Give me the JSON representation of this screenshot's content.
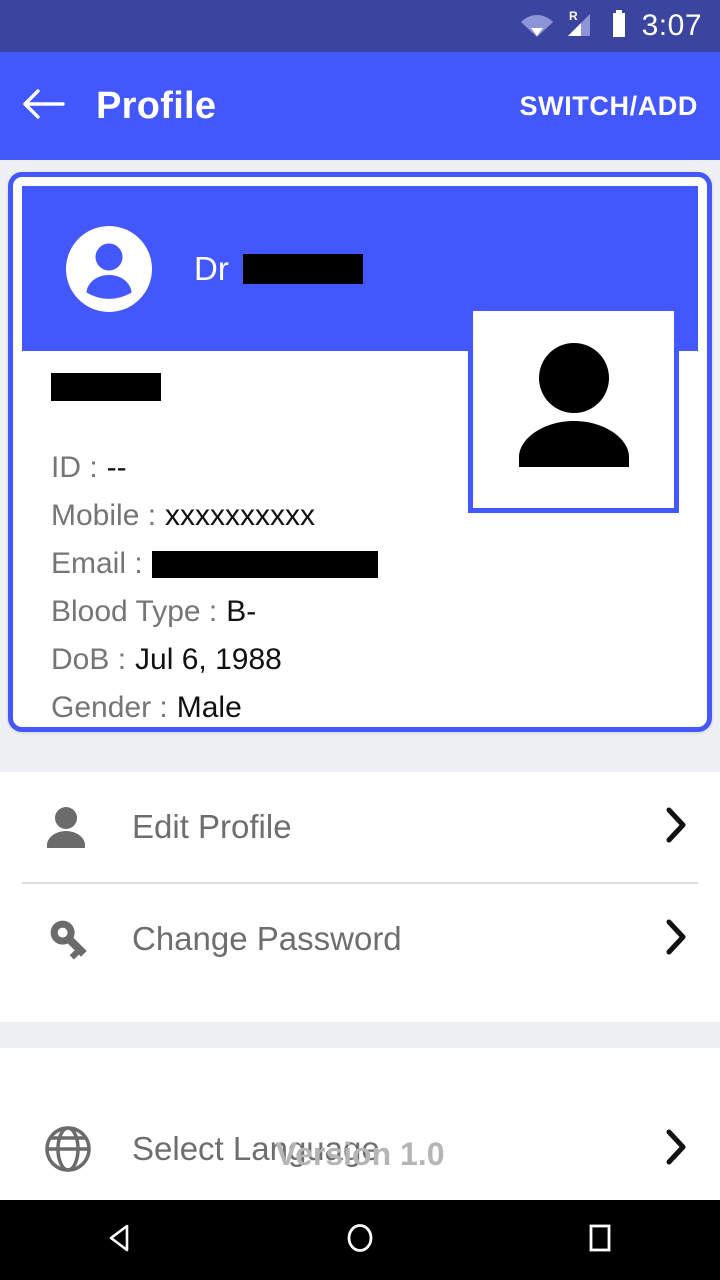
{
  "status_bar": {
    "time": "3:07",
    "icons": [
      "wifi-icon",
      "cellular-roaming-icon",
      "battery-icon"
    ],
    "roaming_letter": "R",
    "background": "#3b449e"
  },
  "app_bar": {
    "back_icon": "arrow-left-icon",
    "title": "Profile",
    "action_label": "SWITCH/ADD",
    "background": "#4257fc"
  },
  "profile_card": {
    "border_color": "#4257fc",
    "header": {
      "avatar_icon": "account-circle-icon",
      "title_prefix": "Dr",
      "name_redacted": true
    },
    "photo": {
      "icon": "person-placeholder-icon",
      "border_color": "#4257fc"
    },
    "name_redacted": true,
    "fields": [
      {
        "label": "ID :",
        "value": "--",
        "redacted": false
      },
      {
        "label": "Mobile :",
        "value": "xxxxxxxxxx",
        "redacted": false
      },
      {
        "label": "Email :",
        "value": "",
        "redacted": true
      },
      {
        "label": "Blood Type :",
        "value": "B-",
        "redacted": false
      },
      {
        "label": "DoB :",
        "value": "Jul 6, 1988",
        "redacted": false
      },
      {
        "label": "Gender :",
        "value": "Male",
        "redacted": false
      }
    ]
  },
  "menu": {
    "group_one": [
      {
        "label": "Edit Profile",
        "icon": "person-icon",
        "chevron": "chevron-right-icon"
      },
      {
        "label": "Change Password",
        "icon": "key-icon",
        "chevron": "chevron-right-icon"
      }
    ],
    "group_two": [
      {
        "label": "Select Language",
        "icon": "globe-icon",
        "chevron": "chevron-right-icon"
      }
    ]
  },
  "footer": {
    "version": "Version 1.0"
  },
  "nav_bar": {
    "back": "nav-back-icon",
    "home": "nav-home-icon",
    "recents": "nav-recents-icon"
  }
}
